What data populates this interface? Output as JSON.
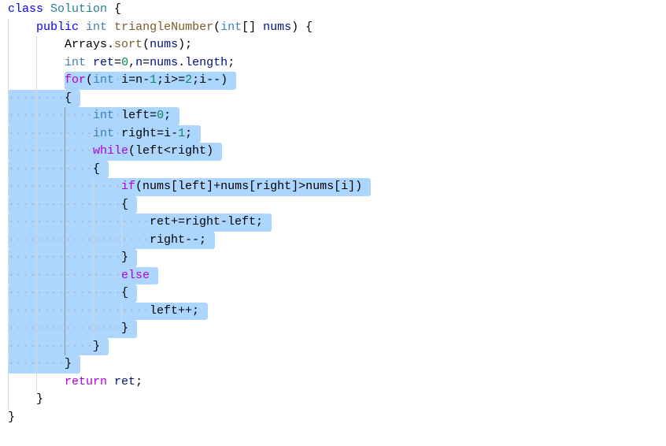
{
  "editor": {
    "language": "java",
    "colors": {
      "selection": "#add6ff",
      "keyword": "#0000ff",
      "control": "#af00db",
      "number": "#098658",
      "function": "#795e26",
      "class": "#267f99"
    },
    "lines": [
      {
        "indent": 0,
        "tokens": [
          [
            "class",
            "kw"
          ],
          [
            " ",
            "plain"
          ],
          [
            "Solution",
            "cls"
          ],
          [
            " {",
            "plain"
          ]
        ]
      },
      {
        "indent": 4,
        "tokens": [
          [
            "public",
            "kw"
          ],
          [
            " ",
            "plain"
          ],
          [
            "int",
            "type"
          ],
          [
            " ",
            "plain"
          ],
          [
            "triangleNumber",
            "fn"
          ],
          [
            "(",
            "plain"
          ],
          [
            "int",
            "type"
          ],
          [
            "[] ",
            "plain"
          ],
          [
            "nums",
            "var"
          ],
          [
            ") {",
            "plain"
          ]
        ]
      },
      {
        "indent": 8,
        "tokens": [
          [
            "Arrays",
            "plain"
          ],
          [
            ".",
            "plain"
          ],
          [
            "sort",
            "fn"
          ],
          [
            "(",
            "plain"
          ],
          [
            "nums",
            "var"
          ],
          [
            ");",
            "plain"
          ]
        ]
      },
      {
        "indent": 8,
        "tokens": [
          [
            "int",
            "type"
          ],
          [
            " ",
            "plain"
          ],
          [
            "ret",
            "var"
          ],
          [
            "=",
            "plain"
          ],
          [
            "0",
            "num"
          ],
          [
            ",",
            "plain"
          ],
          [
            "n",
            "var"
          ],
          [
            "=",
            "plain"
          ],
          [
            "nums",
            "var"
          ],
          [
            ".",
            "plain"
          ],
          [
            "length",
            "var"
          ],
          [
            ";",
            "plain"
          ]
        ]
      },
      {
        "indent": 8,
        "sel": true,
        "selFrom": 8,
        "tokens": [
          [
            "for",
            "ctl"
          ],
          [
            "(",
            "plain"
          ],
          [
            "int",
            "type"
          ],
          [
            " i=n-",
            "plain"
          ],
          [
            "1",
            "num"
          ],
          [
            ";i>=",
            "plain"
          ],
          [
            "2",
            "num"
          ],
          [
            ";i--)",
            "plain"
          ]
        ]
      },
      {
        "indent": 8,
        "sel": true,
        "selFrom": 0,
        "tokens": [
          [
            "{",
            "plain"
          ]
        ]
      },
      {
        "indent": 12,
        "sel": true,
        "selFrom": 0,
        "tokens": [
          [
            "int",
            "type"
          ],
          [
            " left=",
            "plain"
          ],
          [
            "0",
            "num"
          ],
          [
            ";",
            "plain"
          ]
        ]
      },
      {
        "indent": 12,
        "sel": true,
        "selFrom": 0,
        "tokens": [
          [
            "int",
            "type"
          ],
          [
            " right=i-",
            "plain"
          ],
          [
            "1",
            "num"
          ],
          [
            ";",
            "plain"
          ]
        ]
      },
      {
        "indent": 12,
        "sel": true,
        "selFrom": 0,
        "tokens": [
          [
            "while",
            "ctl"
          ],
          [
            "(left<right)",
            "plain"
          ]
        ]
      },
      {
        "indent": 12,
        "sel": true,
        "selFrom": 0,
        "tokens": [
          [
            "{",
            "plain"
          ]
        ]
      },
      {
        "indent": 16,
        "sel": true,
        "selFrom": 0,
        "tokens": [
          [
            "if",
            "ctl"
          ],
          [
            "(nums[left]+nums[right]>nums[i])",
            "plain"
          ]
        ]
      },
      {
        "indent": 16,
        "sel": true,
        "selFrom": 0,
        "tokens": [
          [
            "{",
            "plain"
          ]
        ]
      },
      {
        "indent": 20,
        "sel": true,
        "selFrom": 0,
        "tokens": [
          [
            "ret+=right-left;",
            "plain"
          ]
        ]
      },
      {
        "indent": 20,
        "sel": true,
        "selFrom": 0,
        "tokens": [
          [
            "right--;",
            "plain"
          ]
        ]
      },
      {
        "indent": 16,
        "sel": true,
        "selFrom": 0,
        "tokens": [
          [
            "}",
            "plain"
          ]
        ]
      },
      {
        "indent": 16,
        "sel": true,
        "selFrom": 0,
        "tokens": [
          [
            "else",
            "ctl"
          ]
        ]
      },
      {
        "indent": 16,
        "sel": true,
        "selFrom": 0,
        "tokens": [
          [
            "{",
            "plain"
          ]
        ]
      },
      {
        "indent": 20,
        "sel": true,
        "selFrom": 0,
        "tokens": [
          [
            "left++;",
            "plain"
          ]
        ]
      },
      {
        "indent": 16,
        "sel": true,
        "selFrom": 0,
        "tokens": [
          [
            "}",
            "plain"
          ]
        ]
      },
      {
        "indent": 12,
        "sel": true,
        "selFrom": 0,
        "tokens": [
          [
            "}",
            "plain"
          ]
        ]
      },
      {
        "indent": 8,
        "sel": true,
        "selFrom": 0,
        "tokens": [
          [
            "}",
            "plain"
          ]
        ]
      },
      {
        "indent": 8,
        "tokens": [
          [
            "return",
            "ctl"
          ],
          [
            " ",
            "plain"
          ],
          [
            "ret",
            "var"
          ],
          [
            ";",
            "plain"
          ]
        ]
      },
      {
        "indent": 4,
        "tokens": [
          [
            "}",
            "plain"
          ]
        ]
      },
      {
        "indent": 0,
        "tokens": [
          [
            "}",
            "plain"
          ]
        ]
      }
    ]
  }
}
